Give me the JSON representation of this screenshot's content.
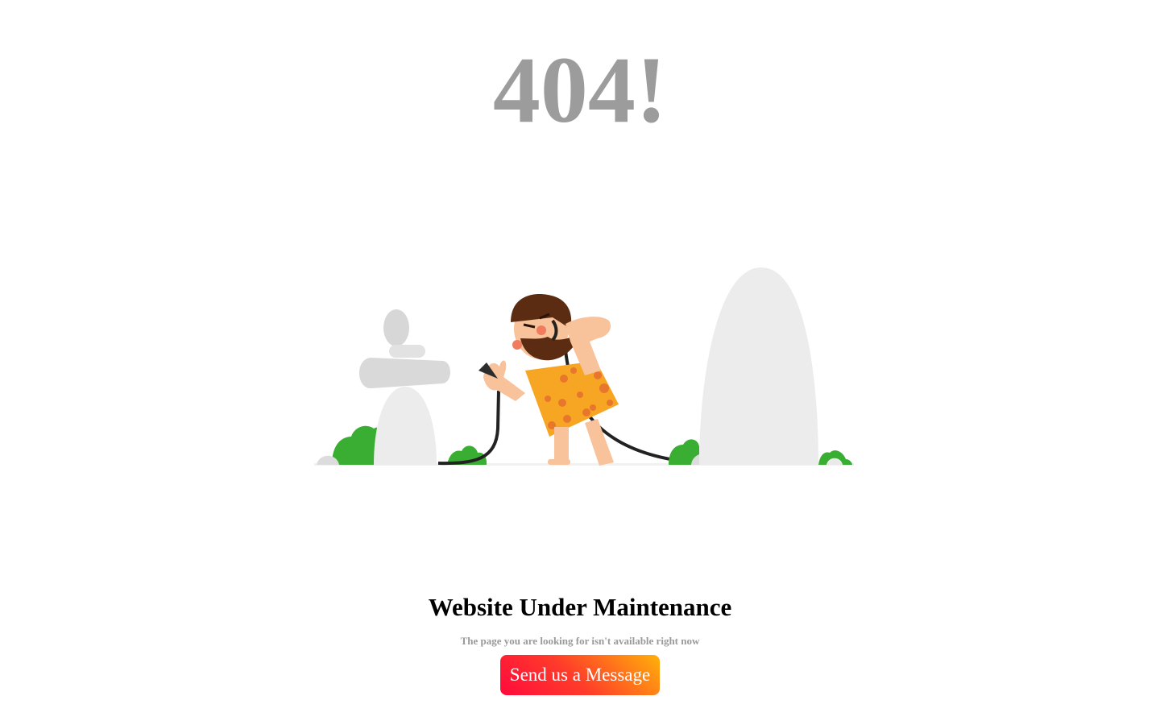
{
  "error": {
    "code": "404!"
  },
  "main": {
    "title": "Website Under Maintenance",
    "subtitle": "The page you are looking for isn't available right now",
    "button_label": "Send us a Message"
  },
  "colors": {
    "code_text": "#9c9c9c",
    "button_gradient_start": "#ff0a3c",
    "button_gradient_end": "#ffb10a",
    "bush": "#3aae32",
    "rock": "#ececec",
    "skin": "#f8c29a",
    "hair": "#5b2c12",
    "clothing": "#f6a623"
  },
  "illustration": {
    "icon": "caveman-with-phone-illustration"
  }
}
